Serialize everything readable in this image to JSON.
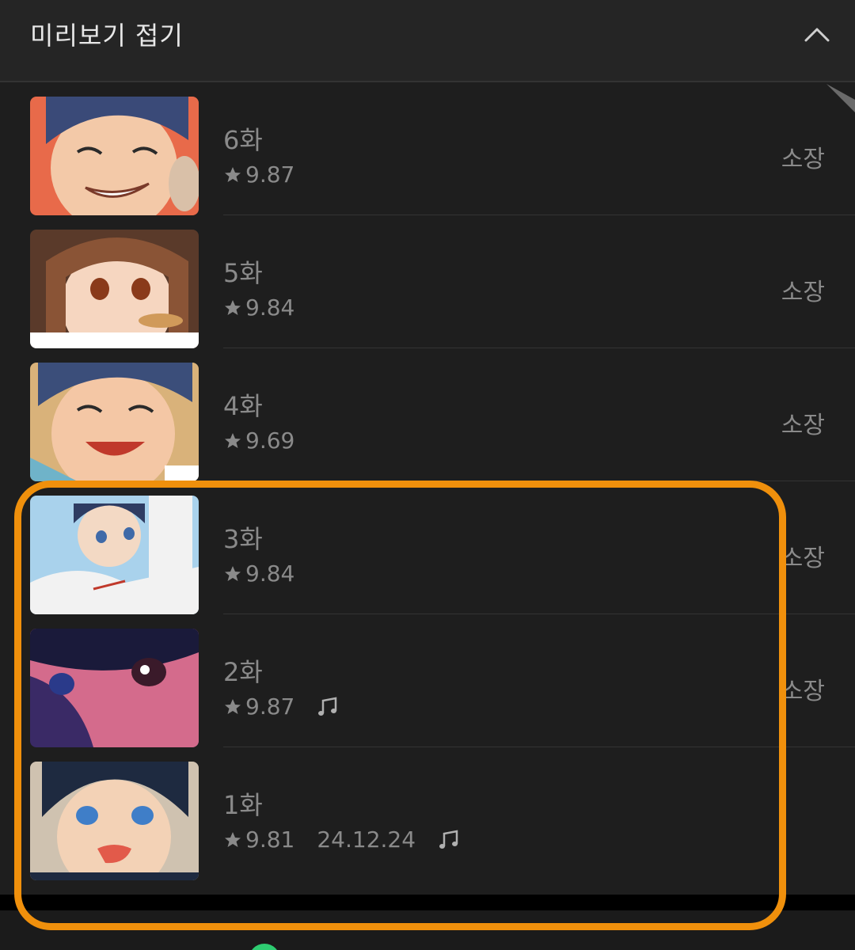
{
  "header": {
    "title": "미리보기 접기",
    "collapse_icon": "chevron-up-icon"
  },
  "episodes": [
    {
      "title": "6화",
      "rating": "9.87",
      "date": "",
      "music": false,
      "status": "소장",
      "thumb_palette": [
        "#e86a4a",
        "#3a4a78",
        "#f3c9a8"
      ]
    },
    {
      "title": "5화",
      "rating": "9.84",
      "date": "",
      "music": false,
      "status": "소장",
      "thumb_palette": [
        "#5a3a2a",
        "#8a5436",
        "#f6d6c0"
      ]
    },
    {
      "title": "4화",
      "rating": "9.69",
      "date": "",
      "music": false,
      "status": "소장",
      "thumb_palette": [
        "#d9b27a",
        "#3b4e7a",
        "#f4c7a5"
      ]
    },
    {
      "title": "3화",
      "rating": "9.84",
      "date": "",
      "music": false,
      "status": "소장",
      "thumb_palette": [
        "#a9d2ec",
        "#2e3c62",
        "#f2f2f2"
      ]
    },
    {
      "title": "2화",
      "rating": "9.87",
      "date": "",
      "music": true,
      "status": "소장",
      "thumb_palette": [
        "#3a2a66",
        "#d46b8c",
        "#1a1a3a"
      ]
    },
    {
      "title": "1화",
      "rating": "9.81",
      "date": "24.12.24",
      "music": true,
      "status": "",
      "thumb_palette": [
        "#cfc2b0",
        "#1e2a40",
        "#f3d2b6"
      ]
    }
  ],
  "colors": {
    "background": "#1e1e1e",
    "header_bg": "#252525",
    "text_muted": "#8a8a8a",
    "text_header": "#e8e8e8",
    "highlight": "#f0900c"
  }
}
